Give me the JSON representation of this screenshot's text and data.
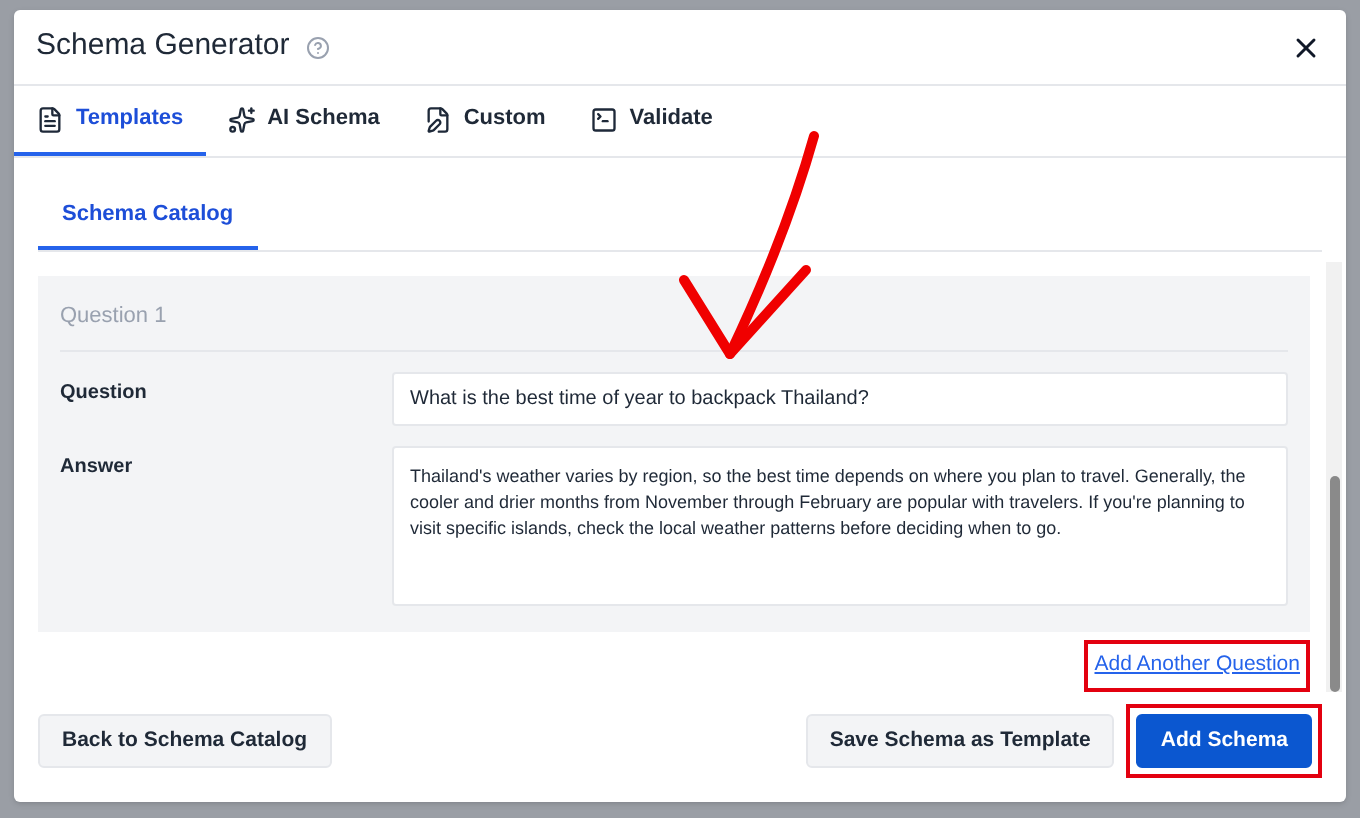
{
  "dialog": {
    "title": "Schema Generator"
  },
  "tabs": [
    {
      "label": "Templates",
      "selected": true
    },
    {
      "label": "AI Schema",
      "selected": false
    },
    {
      "label": "Custom",
      "selected": false
    },
    {
      "label": "Validate",
      "selected": false
    }
  ],
  "subtabs": [
    {
      "label": "Schema Catalog",
      "selected": true
    }
  ],
  "faq": {
    "heading": "Question 1",
    "fields": [
      {
        "label": "Question",
        "kind": "input",
        "value": "What is the best time of year to backpack Thailand?"
      },
      {
        "label": "Answer",
        "kind": "textarea",
        "value": "Thailand's weather varies by region, so the best time depends on where you plan to travel. Generally, the cooler and drier months from November through February are popular with travelers. If you're planning to visit specific islands, check the local weather patterns before deciding when to go."
      }
    ]
  },
  "add_link": {
    "label": "Add Another Question",
    "highlighted": true
  },
  "footer": {
    "buttons": [
      {
        "label": "Back to Schema Catalog",
        "kind": "secondary",
        "highlighted": false
      },
      {
        "label": "Save Schema as Template",
        "kind": "secondary",
        "highlighted": false
      },
      {
        "label": "Add Schema",
        "kind": "primary",
        "highlighted": true
      }
    ]
  }
}
